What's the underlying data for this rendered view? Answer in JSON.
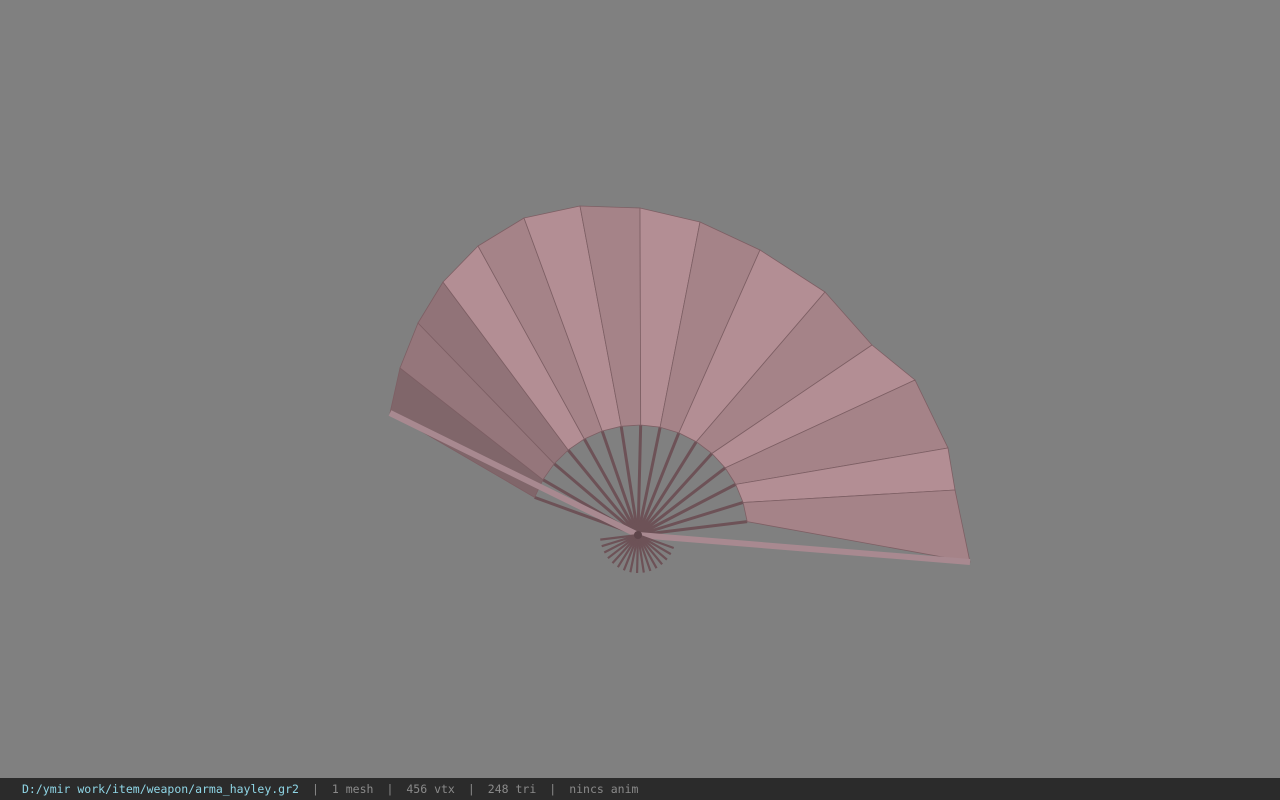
{
  "viewport": {
    "model_icon": "folding-fan",
    "background_color": "#808080",
    "model_color": "#b38e94"
  },
  "status": {
    "path": "D:/ymir work/item/weapon/arma_hayley.gr2",
    "separator": "|",
    "mesh": "1 mesh",
    "vertices": "456 vtx",
    "triangles": "248 tri",
    "anim": "nincs anim",
    "path_color": "#8fd6e6",
    "text_color": "#8a8a8a",
    "background_color": "#2b2b2b"
  }
}
